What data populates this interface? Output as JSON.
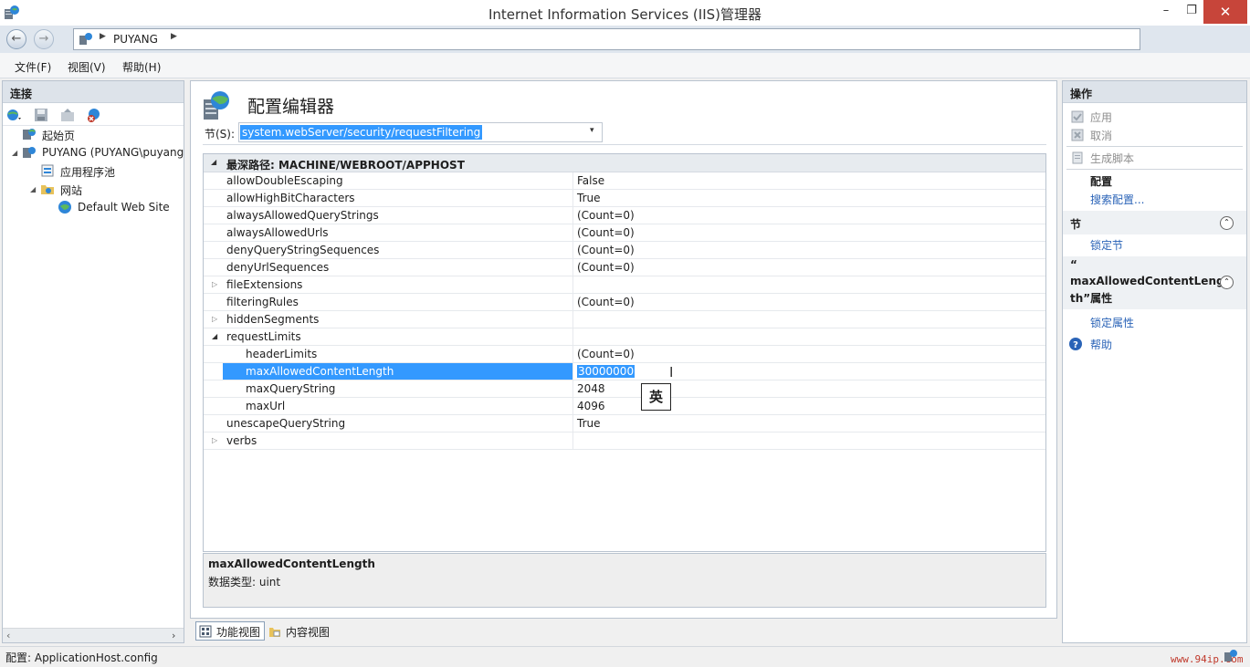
{
  "window": {
    "title": "Internet Information Services (IIS)管理器",
    "min_glyph": "–",
    "max_glyph": "❐",
    "close_glyph": "✕"
  },
  "address": {
    "back_glyph": "←",
    "forward_glyph": "→",
    "separator": "▶",
    "server": "PUYANG",
    "trail_separator": "▶",
    "help_drop_glyph": "▼"
  },
  "menu": {
    "file": "文件(F)",
    "view": "视图(V)",
    "help": "帮助(H)"
  },
  "connections": {
    "title": "连接",
    "tree": [
      {
        "label": "起始页"
      },
      {
        "label": "PUYANG (PUYANG\\puyang"
      },
      {
        "label": "应用程序池"
      },
      {
        "label": "网站"
      },
      {
        "label": "Default Web Site"
      }
    ],
    "expand_glyph": "◢",
    "scroll_left": "‹",
    "scroll_right": "›"
  },
  "editor": {
    "title": "配置编辑器",
    "section_label": "节(S):",
    "section_value": "system.webServer/security/requestFiltering",
    "section_drop_glyph": "▾",
    "grid_header": "最深路径: MACHINE/WEBROOT/APPHOST",
    "grid_header_glyph": "◢",
    "collapsed_glyph": "▷",
    "expanded_glyph": "◢",
    "rows": [
      {
        "key": "allowDoubleEscaping",
        "value": "False"
      },
      {
        "key": "allowHighBitCharacters",
        "value": "True"
      },
      {
        "key": "alwaysAllowedQueryStrings",
        "value": "(Count=0)"
      },
      {
        "key": "alwaysAllowedUrls",
        "value": "(Count=0)"
      },
      {
        "key": "denyQueryStringSequences",
        "value": "(Count=0)"
      },
      {
        "key": "denyUrlSequences",
        "value": "(Count=0)"
      },
      {
        "key": "fileExtensions",
        "value": ""
      },
      {
        "key": "filteringRules",
        "value": "(Count=0)"
      },
      {
        "key": "hiddenSegments",
        "value": ""
      },
      {
        "key": "requestLimits",
        "value": ""
      },
      {
        "key": "headerLimits",
        "value": "(Count=0)"
      },
      {
        "key": "maxAllowedContentLength",
        "value": "30000000"
      },
      {
        "key": "maxQueryString",
        "value": "2048"
      },
      {
        "key": "maxUrl",
        "value": "4096"
      },
      {
        "key": "unescapeQueryString",
        "value": "True"
      },
      {
        "key": "verbs",
        "value": ""
      }
    ],
    "ime_indicator": "英",
    "cursor_glyph": "I",
    "description": {
      "name": "maxAllowedContentLength",
      "type": "数据类型: uint"
    }
  },
  "view_tabs": {
    "features": "功能视图",
    "content": "内容视图"
  },
  "actions": {
    "title": "操作",
    "apply": "应用",
    "cancel": "取消",
    "generate_script": "生成脚本",
    "config_heading": "配置",
    "search_config": "搜索配置...",
    "section_heading": "节",
    "lock_section": "锁定节",
    "attribute_heading_line1": "“",
    "attribute_heading_line2": "maxAllowedContentLeng",
    "attribute_heading_line3": "th”属性",
    "lock_attribute": "锁定属性",
    "help": "帮助",
    "collapse_glyph": "⌃"
  },
  "status": {
    "text": "配置: ApplicationHost.config",
    "watermark": "www.94ip.com"
  },
  "colors": {
    "selection": "#3399ff",
    "link": "#2a63b7",
    "close": "#c7453a"
  }
}
